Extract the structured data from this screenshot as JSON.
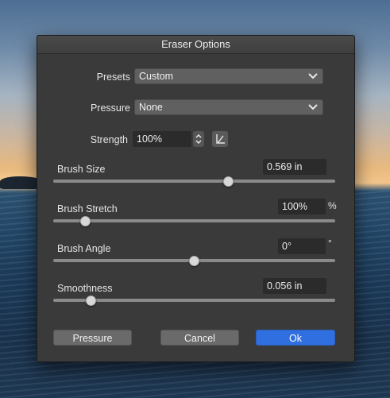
{
  "dialog": {
    "title": "Eraser Options"
  },
  "presets": {
    "label": "Presets",
    "value": "Custom"
  },
  "pressure": {
    "label": "Pressure",
    "value": "None"
  },
  "strength": {
    "label": "Strength",
    "value": "100%"
  },
  "sliders": [
    {
      "label": "Brush Size",
      "value": "0.569 in",
      "unit": "",
      "level": 0.62
    },
    {
      "label": "Brush Stretch",
      "value": "100%",
      "unit": "%",
      "level": 0.115
    },
    {
      "label": "Brush Angle",
      "value": "0°",
      "unit": "°",
      "level": 0.5
    },
    {
      "label": "Smoothness",
      "value": "0.056 in",
      "unit": "",
      "level": 0.135
    }
  ],
  "buttons": {
    "pressure": "Pressure",
    "cancel": "Cancel",
    "ok": "Ok"
  },
  "colors": {
    "accent": "#2f6fe0",
    "dialog_bg": "#3a3a3a",
    "field_bg": "#2b2b2b"
  },
  "icons": {
    "dropdown": "chevron-down-icon",
    "stepper": "stepper-icon",
    "curve": "pressure-curve-icon"
  }
}
